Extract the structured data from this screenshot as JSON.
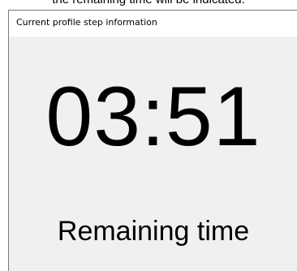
{
  "caption": {
    "text": "the remaining time will be indicated."
  },
  "window": {
    "title": "Current profile step information"
  },
  "timer": {
    "value": "03:51",
    "label": "Remaining time"
  },
  "colors": {
    "window_background": "#f0f0f0",
    "title_bar_background": "#ffffff",
    "text": "#000000"
  }
}
